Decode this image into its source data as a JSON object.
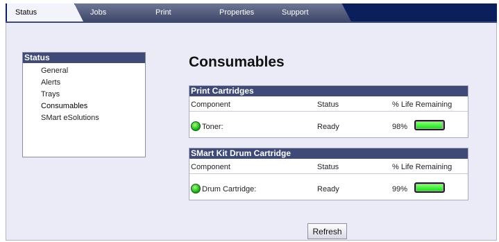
{
  "tabs": [
    "Status",
    "Jobs",
    "Print",
    "Properties",
    "Support"
  ],
  "sidebar": {
    "title": "Status",
    "items": [
      "General",
      "Alerts",
      "Trays",
      "Consumables",
      "SMart eSolutions"
    ]
  },
  "main": {
    "title": "Consumables",
    "print_cartridges": {
      "header": "Print Cartridges",
      "columns": [
        "Component",
        "Status",
        "% Life Remaining"
      ],
      "component": "Toner:",
      "status": "Ready",
      "life": "98%",
      "life_fraction": 0.98
    },
    "drum": {
      "header": "SMart Kit Drum Cartridge",
      "columns": [
        "Component",
        "Status",
        "% Life Remaining"
      ],
      "component": "Drum Cartridge:",
      "status": "Ready",
      "life": "99%",
      "life_fraction": 0.99
    },
    "refresh_label": "Refresh"
  },
  "colors": {
    "tab_bar": "#0b1f5c",
    "section_header": "#3f4a77",
    "meter_fill": "#1ee01e",
    "status_ok": "#13a513"
  }
}
